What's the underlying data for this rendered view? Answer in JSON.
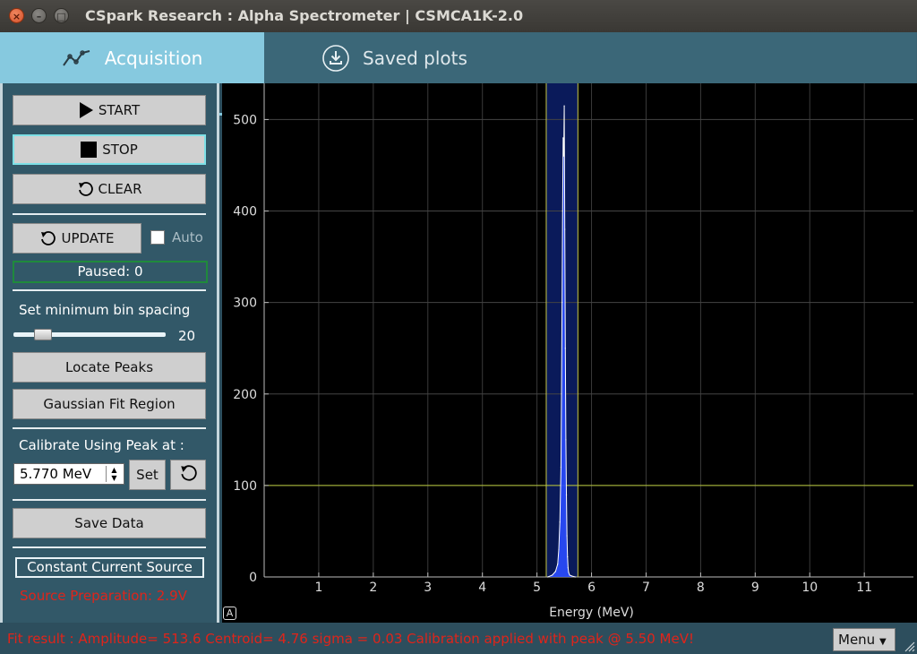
{
  "window": {
    "title": "CSpark Research : Alpha Spectrometer | CSMCA1K-2.0"
  },
  "tabs": [
    {
      "label": "Acquisition",
      "icon": "chart-line-icon",
      "active": true
    },
    {
      "label": "Saved plots",
      "icon": "download-icon",
      "active": false
    }
  ],
  "controls": {
    "start_label": "START",
    "stop_label": "STOP",
    "clear_label": "CLEAR",
    "update_label": "UPDATE",
    "auto_label": "Auto",
    "auto_checked": false,
    "paused_text": "Paused: 0",
    "bin_spacing_label": "Set minimum bin spacing",
    "bin_spacing_value": "20",
    "locate_peaks_label": "Locate Peaks",
    "gaussian_fit_label": "Gaussian Fit Region",
    "calibrate_label": "Calibrate Using Peak at :",
    "calibrate_value": "5.770 MeV",
    "set_label": "Set",
    "save_data_label": "Save Data",
    "constant_current_label": "Constant Current Source",
    "source_prep_text": "Source Preparation: 2.9V",
    "autoscale_label": "A"
  },
  "status": {
    "fit_result": "Fit result : Amplitude= 513.6  Centroid=  4.76  sigma =  0.03 Calibration applied with peak @ 5.50 MeV!",
    "menu_label": "Menu"
  },
  "colors": {
    "accent_tab": "#86c9df",
    "panel_bg": "#325868",
    "error_text": "#e0241a",
    "trace": "#2a4cff",
    "region_fill": "#0a1a5a",
    "region_line": "#c8c84a",
    "threshold_line": "#b8c83a"
  },
  "chart_data": {
    "type": "line",
    "xlabel": "Energy (MeV)",
    "ylabel": "",
    "xlim": [
      0.0,
      11.9
    ],
    "ylim": [
      0,
      520
    ],
    "xticks": [
      1,
      2,
      3,
      4,
      5,
      6,
      7,
      8,
      9,
      10,
      11
    ],
    "yticks": [
      0,
      100,
      200,
      300,
      400,
      500
    ],
    "grid": true,
    "region": [
      5.17,
      5.75
    ],
    "threshold": 100,
    "series": [
      {
        "x": [
          5.2,
          5.28,
          5.34,
          5.38,
          5.4,
          5.42,
          5.44,
          5.45,
          5.46,
          5.47,
          5.48,
          5.49,
          5.5,
          5.51,
          5.52,
          5.53,
          5.54,
          5.55,
          5.56,
          5.57,
          5.58,
          5.6,
          5.64,
          5.7
        ],
        "values": [
          0,
          2,
          6,
          14,
          30,
          60,
          120,
          200,
          300,
          400,
          480,
          460,
          515,
          380,
          250,
          150,
          90,
          45,
          22,
          10,
          5,
          2,
          1,
          0
        ]
      }
    ]
  }
}
